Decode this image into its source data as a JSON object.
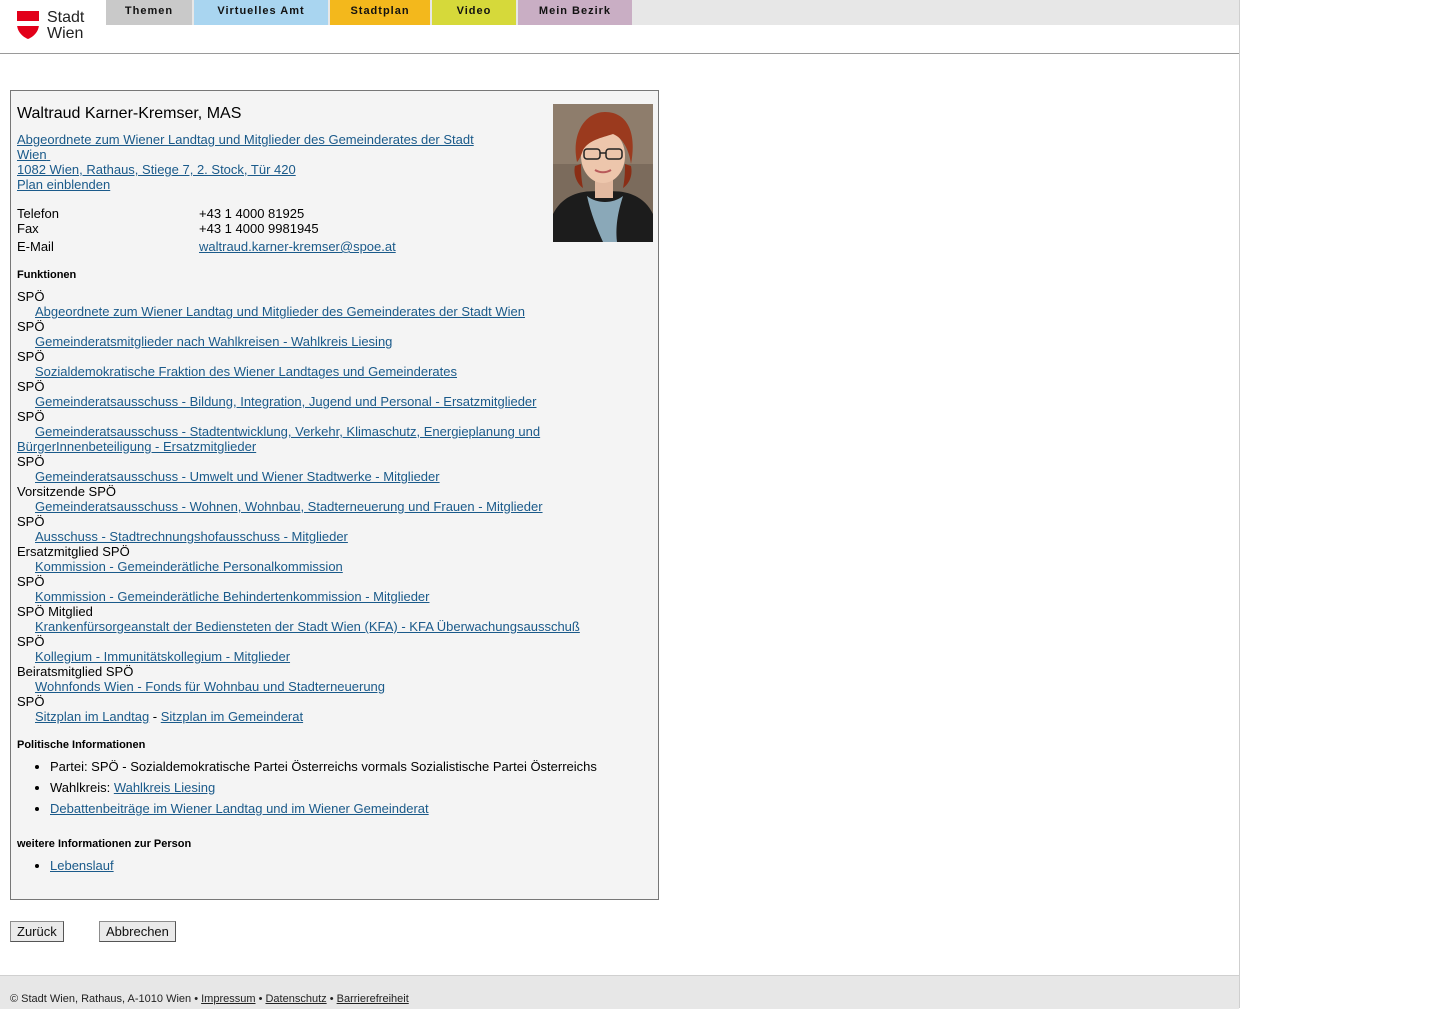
{
  "header": {
    "logo": {
      "line1": "Stadt",
      "line2": "Wien",
      "icon": "vienna-shield-icon",
      "shield_color": "#e2001a"
    },
    "nav": [
      {
        "label": "Themen",
        "color": "#c9c9c9"
      },
      {
        "label": "Virtuelles Amt",
        "color": "#a9d5f0"
      },
      {
        "label": "Stadtplan",
        "color": "#f3b81c"
      },
      {
        "label": "Video",
        "color": "#d6d93a"
      },
      {
        "label": "Mein Bezirk",
        "color": "#c9aec4"
      }
    ]
  },
  "person": {
    "name": "Waltraud Karner-Kremser, MAS",
    "role_line1": "Abgeordnete zum Wiener Landtag und Mitglieder des Gemeinderates der Stadt",
    "role_line2": "Wien",
    "address": "1082 Wien, Rathaus, Stiege 7, 2. Stock, Tür 420",
    "plan_link": "Plan einblenden",
    "contact": {
      "phone_label": "Telefon",
      "phone": "+43 1 4000 81925",
      "fax_label": "Fax",
      "fax": "+43 1 4000 9981945",
      "email_label": "E-Mail",
      "email": "waltraud.karner-kremser@spoe.at"
    }
  },
  "functions": {
    "heading": "Funktionen",
    "items": [
      {
        "role": "SPÖ",
        "link": "Abgeordnete zum Wiener Landtag und Mitglieder des Gemeinderates der Stadt Wien"
      },
      {
        "role": "SPÖ",
        "link": "Gemeinderatsmitglieder nach Wahlkreisen - Wahlkreis Liesing"
      },
      {
        "role": "SPÖ",
        "link": "Sozialdemokratische Fraktion des Wiener Landtages und Gemeinderates"
      },
      {
        "role": "SPÖ",
        "link": "Gemeinderatsausschuss - Bildung, Integration, Jugend und Personal - Ersatzmitglieder"
      },
      {
        "role": "SPÖ",
        "link": "Gemeinderatsausschuss - Stadtentwicklung, Verkehr, Klimaschutz, Energieplanung und BürgerInnenbeteiligung - Ersatzmitglieder",
        "wrap": true
      },
      {
        "role": "SPÖ",
        "link": "Gemeinderatsausschuss - Umwelt und Wiener Stadtwerke - Mitglieder"
      },
      {
        "role": "Vorsitzende SPÖ",
        "link": "Gemeinderatsausschuss - Wohnen, Wohnbau, Stadterneuerung und Frauen - Mitglieder"
      },
      {
        "role": "SPÖ",
        "link": "Ausschuss - Stadtrechnungshofausschuss - Mitglieder"
      },
      {
        "role": "Ersatzmitglied SPÖ",
        "link": "Kommission - Gemeinderätliche Personalkommission"
      },
      {
        "role": "SPÖ",
        "link": "Kommission - Gemeinderätliche Behindertenkommission - Mitglieder"
      },
      {
        "role": "SPÖ Mitglied",
        "link": "Krankenfürsorgeanstalt der Bediensteten der Stadt Wien (KFA) - KFA Überwachungsausschuß"
      },
      {
        "role": "SPÖ",
        "link": "Kollegium - Immunitätskollegium - Mitglieder"
      },
      {
        "role": "Beiratsmitglied SPÖ",
        "link": "Wohnfonds Wien - Fonds für Wohnbau und Stadterneuerung"
      }
    ],
    "last_role": "SPÖ",
    "seat_landtag": "Sitzplan im Landtag",
    "seat_sep": " - ",
    "seat_gemeinderat": "Sitzplan im Gemeinderat"
  },
  "political": {
    "heading": "Politische Informationen",
    "party": "Partei: SPÖ - Sozialdemokratische Partei Österreichs vormals Sozialistische Partei Österreichs",
    "district_label": "Wahlkreis: ",
    "district_link": "Wahlkreis Liesing",
    "debates_link": "Debattenbeiträge im Wiener Landtag und im Wiener Gemeinderat"
  },
  "more": {
    "heading": "weitere Informationen zur Person",
    "cv_link": "Lebenslauf"
  },
  "buttons": {
    "back": "Zurück",
    "cancel": "Abbrechen"
  },
  "footer": {
    "copyright": "© Stadt Wien, Rathaus, A-1010 Wien",
    "sep": " • ",
    "impressum": "Impressum",
    "datenschutz": "Datenschutz",
    "barrierefreiheit": "Barrierefreiheit"
  }
}
